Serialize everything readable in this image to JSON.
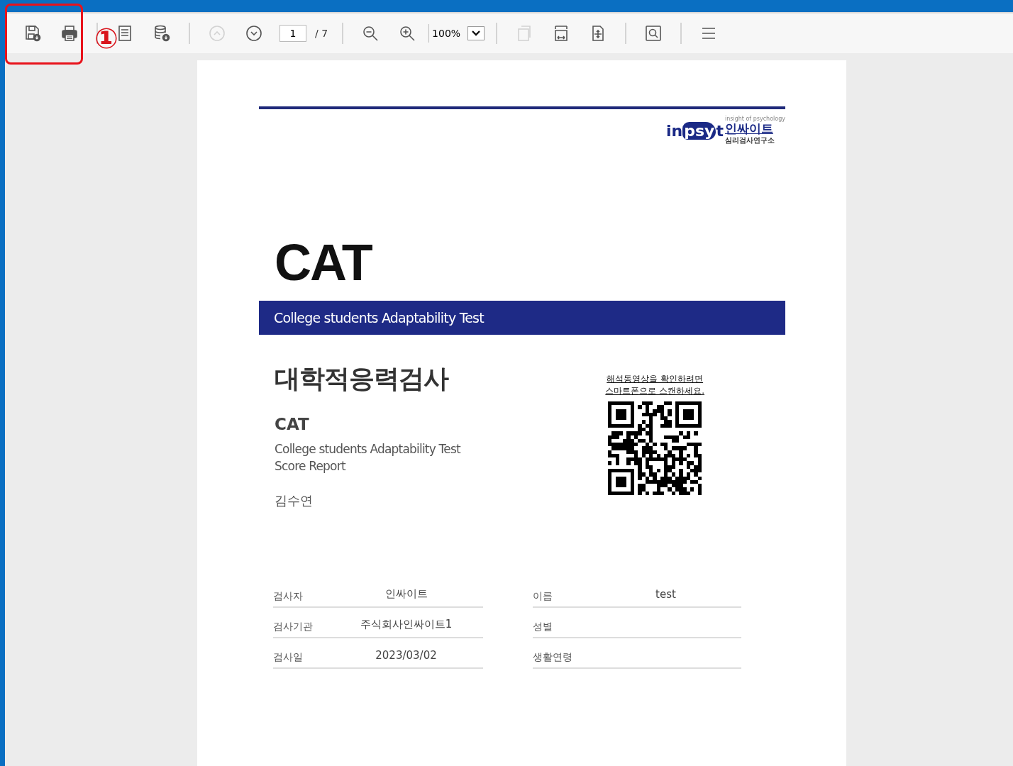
{
  "toolbar": {
    "groups": [
      [
        {
          "kind": "save",
          "disabled": false
        },
        {
          "kind": "print",
          "disabled": false
        }
      ],
      [
        {
          "kind": "document",
          "disabled": false
        },
        {
          "kind": "database",
          "disabled": false
        }
      ],
      [
        {
          "kind": "page-up",
          "disabled": true
        },
        {
          "kind": "page-down",
          "disabled": false
        },
        {
          "kind": "page-field",
          "value": "1",
          "total": "/ 7"
        }
      ],
      [
        {
          "kind": "zoom-out",
          "disabled": false
        },
        {
          "kind": "zoom-in",
          "disabled": false
        },
        {
          "kind": "zoom-select",
          "value": "100%"
        }
      ],
      [
        {
          "kind": "copy",
          "disabled": true
        },
        {
          "kind": "fit-width",
          "disabled": false
        },
        {
          "kind": "fit-page",
          "disabled": false
        }
      ],
      [
        {
          "kind": "find",
          "disabled": false
        }
      ],
      [
        {
          "kind": "menu",
          "disabled": false
        }
      ]
    ]
  },
  "callout": {
    "label": "①"
  },
  "document": {
    "logo": {
      "brand": "inpsyt",
      "tagline": "insight of psychology",
      "name": "인싸이트",
      "subname": "심리검사연구소"
    },
    "title": "CAT",
    "banner": "College students Adaptability Test",
    "korean_title": "대학적응력검사",
    "subtitle": "CAT",
    "description": [
      "College students Adaptability Test",
      "Score Report"
    ],
    "person": "김수연",
    "qr_caption": [
      "해석동영상을 확인하려면",
      "스마트폰으로 스캔하세요."
    ],
    "info_left": [
      {
        "label": "검사자",
        "value": "인싸이트"
      },
      {
        "label": "검사기관",
        "value": "주식회사인싸이트1"
      },
      {
        "label": "검사일",
        "value": "2023/03/02"
      }
    ],
    "info_right": [
      {
        "label": "이름",
        "value": "test"
      },
      {
        "label": "성별"
      },
      {
        "label": "생활연령"
      }
    ]
  }
}
